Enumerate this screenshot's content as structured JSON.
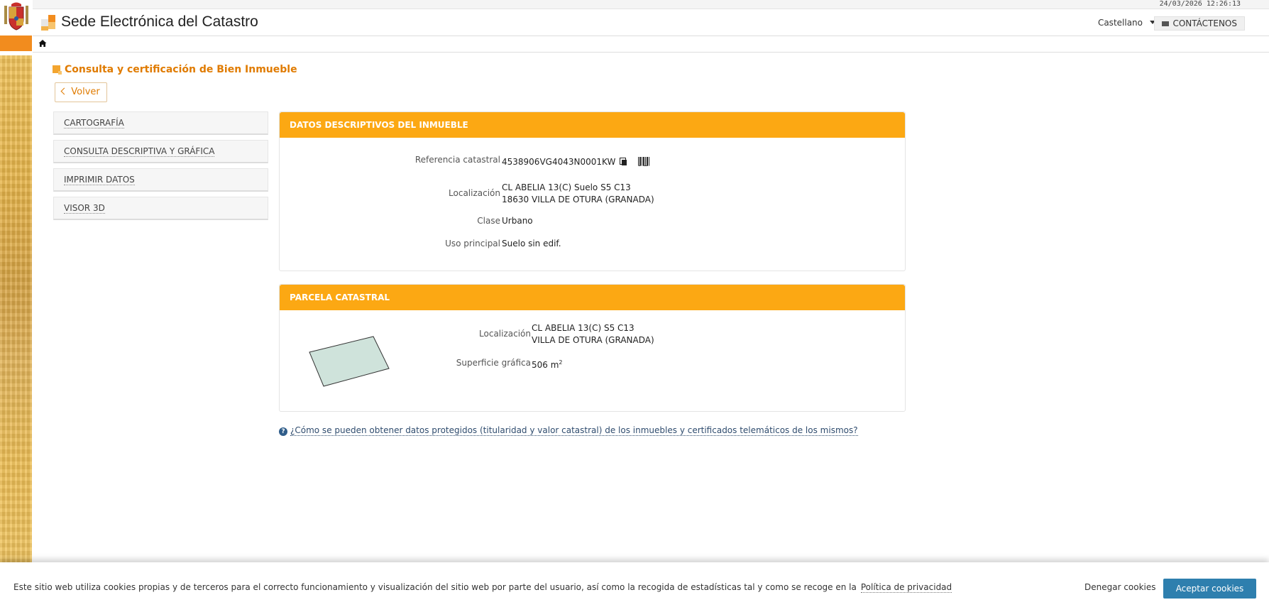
{
  "header": {
    "timestamp": "24/03/2026 12:26:13",
    "title": "Sede Electrónica del Catastro",
    "language": "Castellano",
    "contact_label": "CONTÁCTENOS"
  },
  "page": {
    "title": "Consulta y certificación de Bien Inmueble",
    "back_label": "Volver"
  },
  "side_menu": {
    "items": [
      {
        "label": "CARTOGRAFÍA"
      },
      {
        "label": "CONSULTA DESCRIPTIVA Y GRÁFICA"
      },
      {
        "label": "IMPRIMIR DATOS"
      },
      {
        "label": "VISOR 3D"
      }
    ]
  },
  "datos": {
    "heading": "DATOS DESCRIPTIVOS DEL INMUEBLE",
    "ref_label": "Referencia catastral",
    "ref_value": "4538906VG4043N0001KW",
    "loc_label": "Localización",
    "loc_line1": "CL ABELIA 13(C) Suelo S5 C13",
    "loc_line2": "18630 VILLA DE OTURA (GRANADA)",
    "clase_label": "Clase",
    "clase_value": "Urbano",
    "uso_label": "Uso principal",
    "uso_value": "Suelo sin edif."
  },
  "parcela": {
    "heading": "PARCELA CATASTRAL",
    "loc_label": "Localización",
    "loc_line1": "CL ABELIA 13(C) S5 C13",
    "loc_line2": "VILLA DE OTURA (GRANADA)",
    "sup_label": "Superficie gráfica",
    "sup_value": "506 m",
    "sup_unit_sup": "2",
    "parcel_fill": "#cfe3db"
  },
  "help": {
    "text": "¿Cómo se pueden obtener datos protegidos (titularidad y valor catastral) de los inmuebles y certificados telemáticos de los mismos?"
  },
  "cookies": {
    "text": "Este sitio web utiliza cookies propias y de terceros para el correcto funcionamiento y visualización del sitio web por parte del usuario, así como la recogida de estadísticas tal y como se recoge en la",
    "policy_link": "Política de privacidad",
    "deny_label": "Denegar cookies",
    "accept_label": "Aceptar cookies"
  },
  "colors": {
    "accent_orange": "#fca813",
    "title_orange": "#e07b00",
    "accept_blue": "#2e7fae"
  },
  "icons": [
    "spain-coat-of-arms-icon",
    "logo-blocks-icon",
    "caret-down-icon",
    "envelope-icon",
    "home-icon",
    "chevron-left-icon",
    "copy-icon",
    "barcode-icon",
    "help-icon"
  ]
}
